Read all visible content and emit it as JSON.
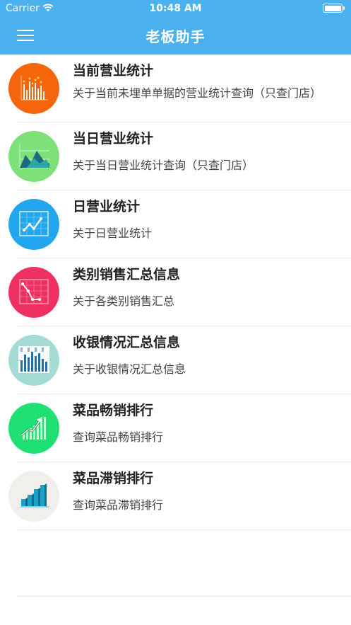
{
  "status_bar": {
    "carrier": "Carrier",
    "time": "10:48 AM"
  },
  "nav": {
    "title": "老板助手",
    "menu_icon": "hamburger-menu-icon"
  },
  "items": [
    {
      "title": "当前营业统计",
      "desc": "关于当前未埋单单据的营业统计查询（只查门店）",
      "icon": "bar-chart-icon",
      "color": "#f5660c"
    },
    {
      "title": "当日营业统计",
      "desc": "关于当日营业统计查询（只查门店）",
      "icon": "mountain-chart-icon",
      "color": "#7ee079"
    },
    {
      "title": "日营业统计",
      "desc": "关于日营业统计",
      "icon": "line-chart-icon",
      "color": "#22a7ee"
    },
    {
      "title": "类别销售汇总信息",
      "desc": "关于各类别销售汇总",
      "icon": "declining-chart-icon",
      "color": "#ee3161"
    },
    {
      "title": "收银情况汇总信息",
      "desc": "关于收银情况汇总信息",
      "icon": "column-chart-icon",
      "color": "#a5dbd5"
    },
    {
      "title": "菜品畅销排行",
      "desc": "查询菜品畅销排行",
      "icon": "rising-chart-icon",
      "color": "#1fe073"
    },
    {
      "title": "菜品滞销排行",
      "desc": "查询菜品滞销排行",
      "icon": "3d-bar-chart-icon",
      "color": "#f1efec"
    }
  ]
}
